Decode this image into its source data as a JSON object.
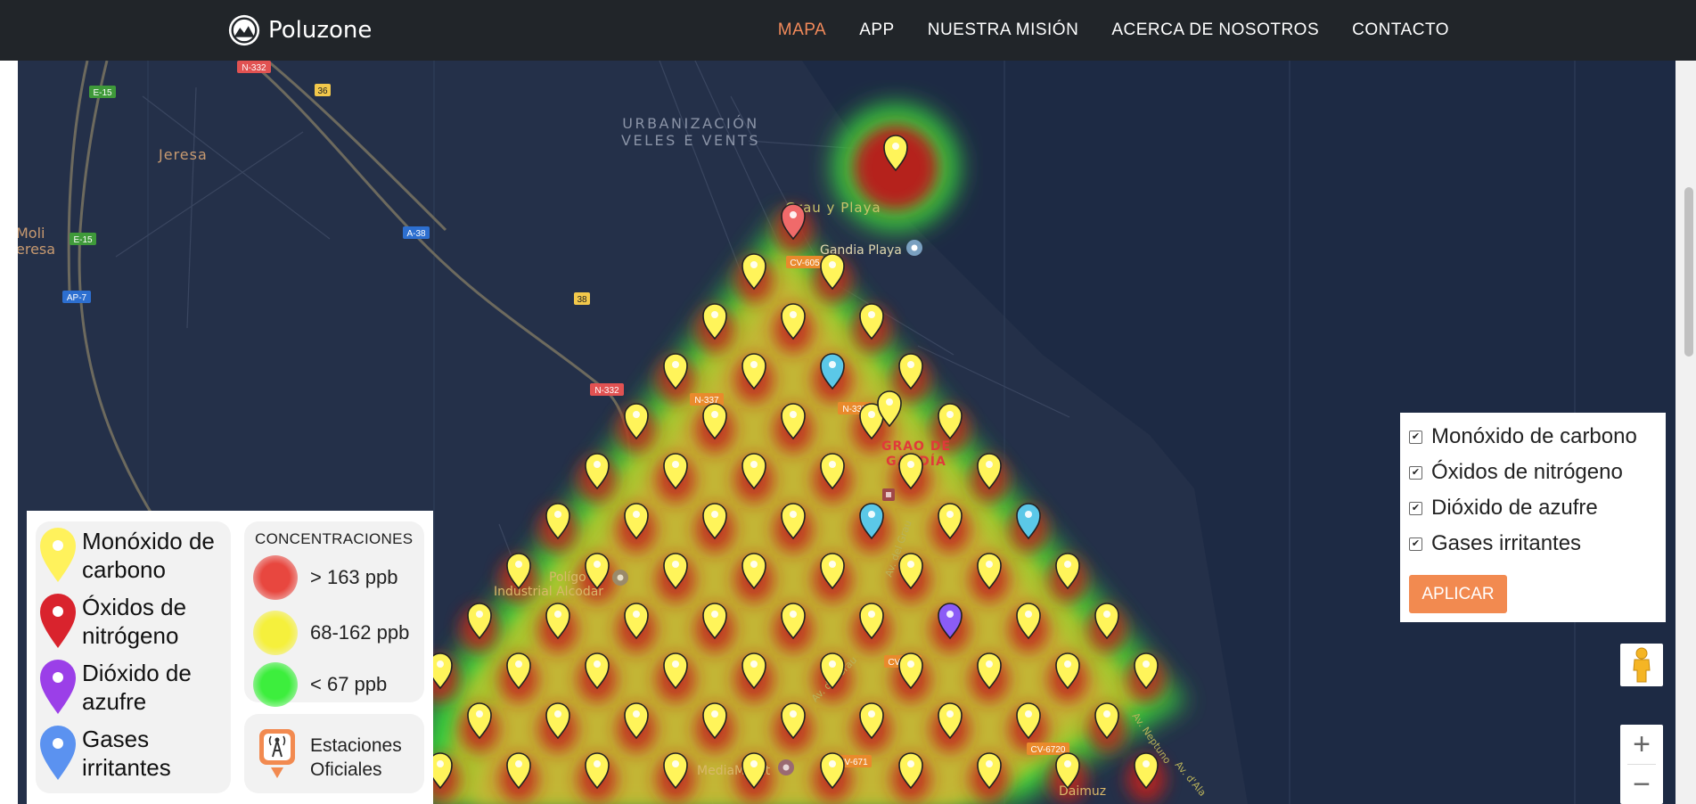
{
  "navbar": {
    "brand": "Poluzone",
    "links": [
      "MAPA",
      "APP",
      "NUESTRA MISIÓN",
      "ACERCA DE NOSOTROS",
      "CONTACTO"
    ],
    "active": "MAPA",
    "accent_color": "#f28a5a"
  },
  "map": {
    "labels": {
      "urbanizacion_1": "URBANIZACIÓN",
      "urbanizacion_2": "VELES E VENTS",
      "jeresa": "Jeresa",
      "moli_1": "Moli",
      "moli_2": "eresa",
      "grau": "Grau y Playa",
      "gandia_playa": "Gandia Playa",
      "grao_1": "GRAO DE",
      "grao_2": "GANDÍA",
      "poligono_1": "Polígo",
      "poligono_2": "Industrial Alcodar",
      "mediamarkt": "MediaMarkt",
      "av_grau": "Av. del Grau",
      "av_grau_2": "Av. del Grau",
      "av_neptuno": "Av. Neptuno",
      "av_alarcon": "Av. d'Ala",
      "daimuz": "Daimuz"
    },
    "road_badges": {
      "e15a": "E-15",
      "e15b": "E-15",
      "ap7": "AP-7",
      "a38": "A-38",
      "n332a": "N-332",
      "n332b": "N-332",
      "r36": "36",
      "r38": "38",
      "n337a": "N-337",
      "n337b": "N-337",
      "cv605": "CV-605",
      "cv670": "CV-670",
      "cv671": "CV-671",
      "cv6720": "CV-6720"
    },
    "marker_colors": {
      "carbon_monoxide": "#fff45a",
      "nitrogen_oxides": "#f06a6a",
      "sulfur_dioxide": "#8b5cf6",
      "irritant_gases": "#5bc8e8"
    }
  },
  "legend": {
    "pollutants": [
      {
        "label": "Monóxido de carbono",
        "color": "#fff25c",
        "icon": "yellow-pin-icon"
      },
      {
        "label": "Óxidos de nitrógeno",
        "color": "#d9232d",
        "icon": "red-pin-icon"
      },
      {
        "label": "Dióxido de azufre",
        "color": "#9b3fe8",
        "icon": "purple-pin-icon"
      },
      {
        "label": "Gases irritantes",
        "color": "#5b92f0",
        "icon": "blue-pin-icon"
      }
    ],
    "concentrations_title": "CONCENTRACIONES",
    "concentrations": [
      {
        "label": "> 163 ppb",
        "color": "#e8473f"
      },
      {
        "label": "68-162 ppb",
        "color": "#f5f03c"
      },
      {
        "label": "< 67 ppb",
        "color": "#3dee3d"
      }
    ],
    "stations_label": "Estaciones Oficiales"
  },
  "filters": {
    "items": [
      {
        "label": "Monóxido de carbono",
        "checked": true
      },
      {
        "label": "Óxidos de nitrógeno",
        "checked": true
      },
      {
        "label": "Dióxido de azufre",
        "checked": true
      },
      {
        "label": "Gases irritantes",
        "checked": true
      }
    ],
    "check_mark": "✔",
    "apply_label": "APLICAR"
  },
  "map_controls": {
    "zoom_in": "+",
    "zoom_out": "−"
  }
}
